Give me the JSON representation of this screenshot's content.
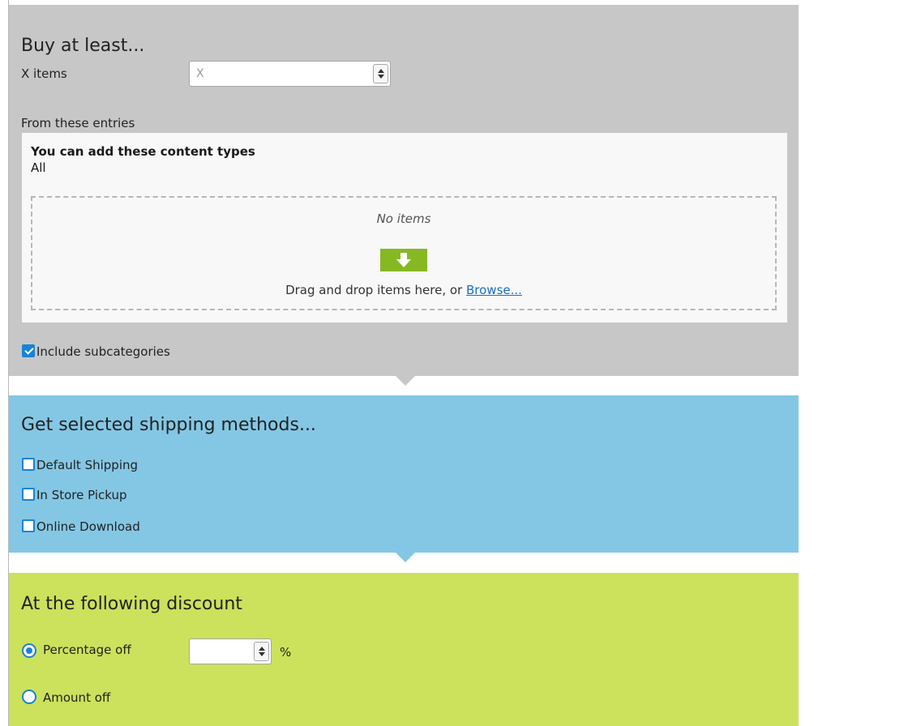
{
  "buy_section": {
    "title": "Buy at least...",
    "items_label": "X items",
    "items_placeholder": "X",
    "entries_label": "From these entries",
    "content_types_title": "You can add these content types",
    "content_types_value": "All",
    "no_items": "No items",
    "drop_hint_prefix": "Drag and drop items here, or ",
    "browse_link": "Browse...",
    "include_subcategories": {
      "label": "Include subcategories",
      "checked": true
    }
  },
  "shipping_section": {
    "title": "Get selected shipping methods...",
    "methods": [
      {
        "label": "Default Shipping",
        "checked": false
      },
      {
        "label": "In Store Pickup",
        "checked": false
      },
      {
        "label": "Online Download",
        "checked": false
      }
    ]
  },
  "discount_section": {
    "title": "At the following discount",
    "options": [
      {
        "label": "Percentage off",
        "selected": true
      },
      {
        "label": "Amount off",
        "selected": false
      }
    ],
    "percent_value": "",
    "percent_unit": "%"
  },
  "colors": {
    "buy_bg": "#c6c7c6",
    "shipping_bg": "#84c7e4",
    "discount_bg": "#cce15c",
    "accent": "#1a82d8",
    "drop_icon": "#86b823",
    "link": "#1a6fc6"
  }
}
